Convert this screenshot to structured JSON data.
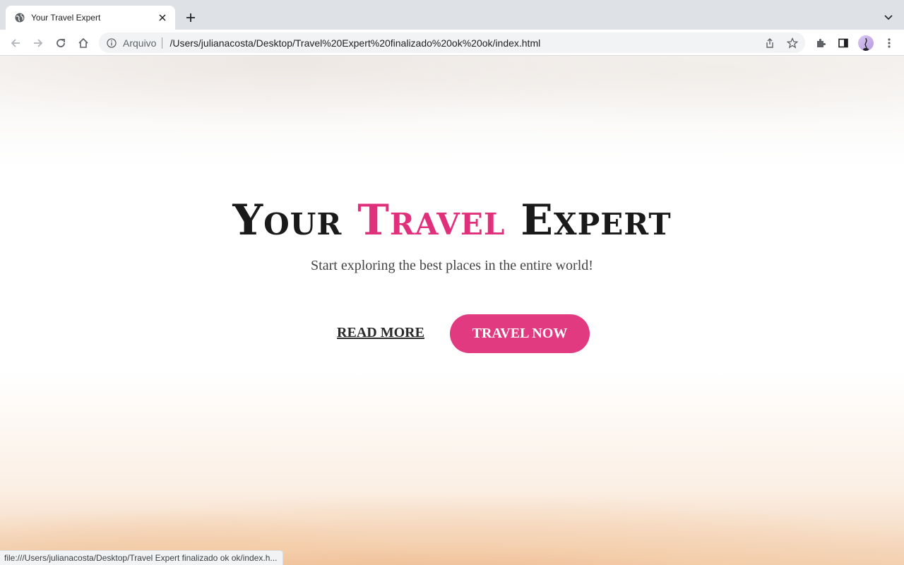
{
  "browser": {
    "tab": {
      "title": "Your Travel Expert"
    },
    "omnibox": {
      "scheme_label": "Arquivo",
      "url": "/Users/julianacosta/Desktop/Travel%20Expert%20finalizado%20ok%20ok/index.html"
    },
    "status_url": "file:///Users/julianacosta/Desktop/Travel Expert finalizado ok ok/index.h..."
  },
  "hero": {
    "title_part1": "Your",
    "title_accent": "Travel",
    "title_part2": "Expert",
    "subtitle": "Start exploring the best places in the entire world!",
    "read_more_label": "READ MORE",
    "travel_now_label": "TRAVEL NOW"
  },
  "colors": {
    "accent": "#e0307c",
    "button": "#e23a81",
    "text": "#1a1a1a"
  }
}
